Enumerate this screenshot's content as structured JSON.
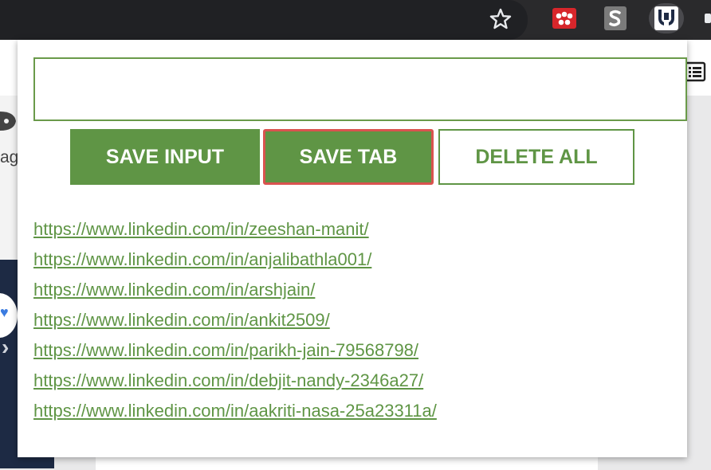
{
  "toolbar": {
    "icons": [
      "star-icon",
      "mendeley-extension-icon",
      "s-extension-icon",
      "hands-extension-icon"
    ]
  },
  "background": {
    "side_text": "ag"
  },
  "popup": {
    "input": {
      "value": "",
      "placeholder": ""
    },
    "buttons": {
      "save_input": "SAVE INPUT",
      "save_tab": "SAVE TAB",
      "delete_all": "DELETE ALL"
    },
    "links": [
      "https://www.linkedin.com/in/zeeshan-manit/",
      "https://www.linkedin.com/in/anjalibathla001/",
      "https://www.linkedin.com/in/arshjain/",
      "https://www.linkedin.com/in/ankit2509/",
      "https://www.linkedin.com/in/parikh-jain-79568798/",
      "https://www.linkedin.com/in/debjit-nandy-2346a27/",
      "https://www.linkedin.com/in/aakriti-nasa-25a23311a/"
    ]
  },
  "colors": {
    "accent_green": "#5f9545",
    "focus_red": "#d9534f",
    "toolbar_dark": "#202124"
  }
}
